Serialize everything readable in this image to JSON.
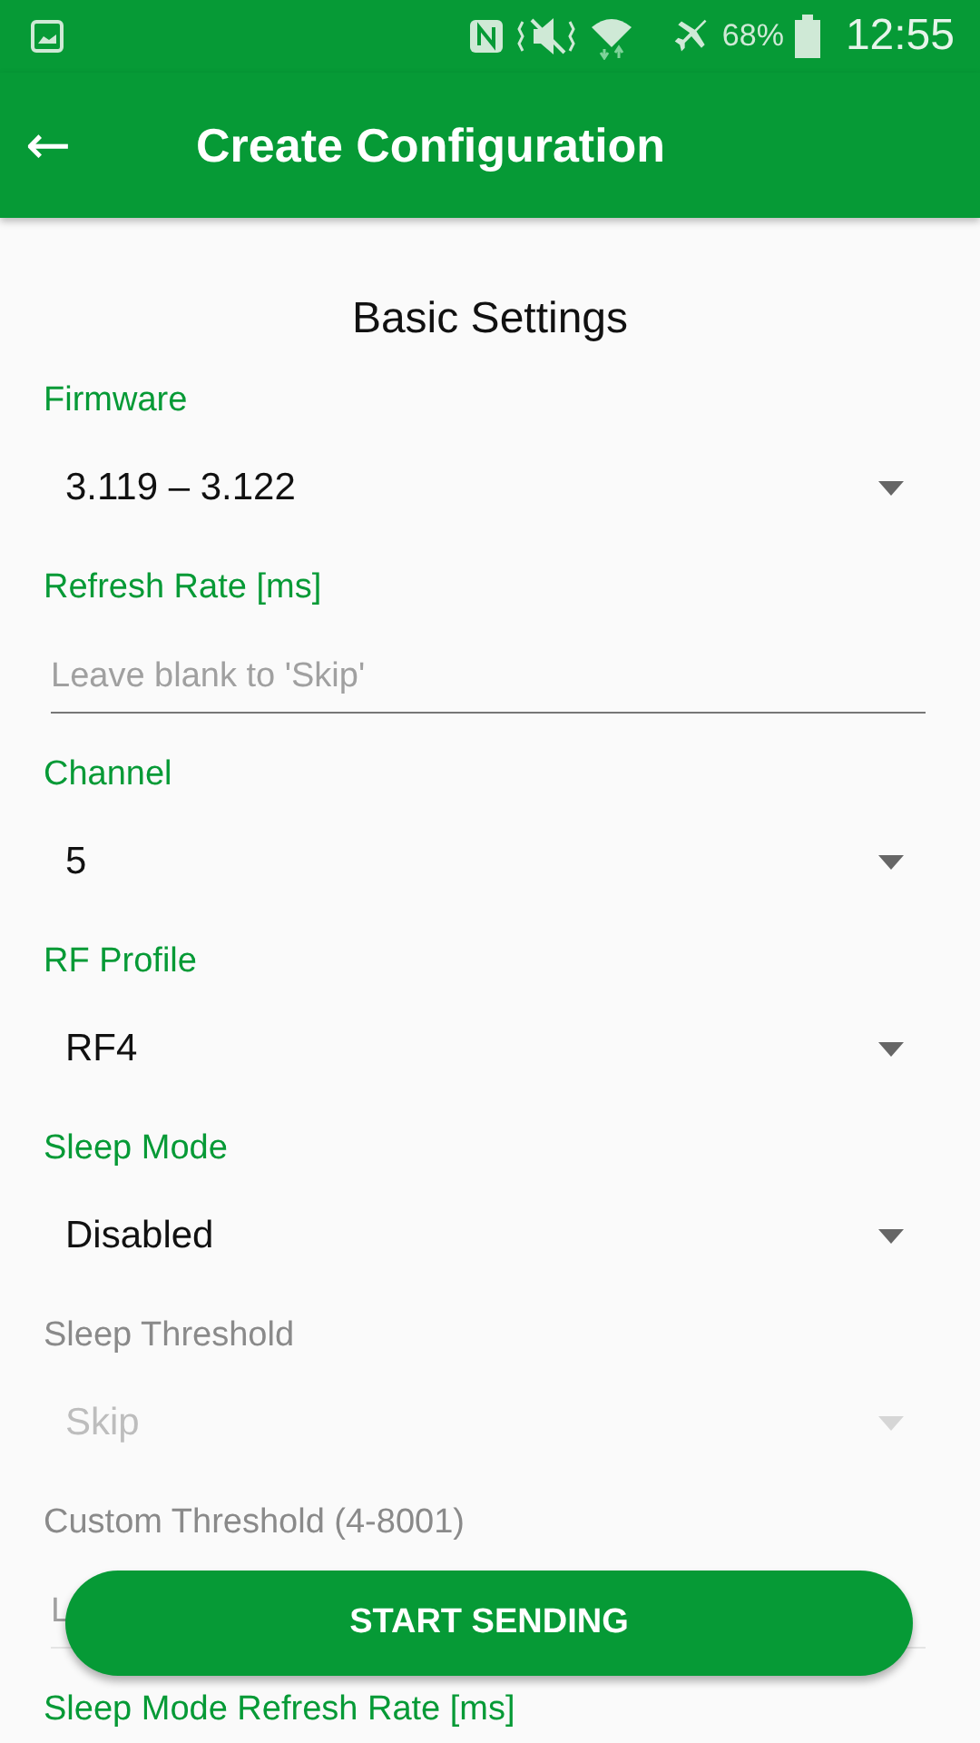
{
  "status_bar": {
    "battery": "68%",
    "time": "12:55"
  },
  "app_bar": {
    "back_icon": "←",
    "title": "Create Configuration"
  },
  "section_title": "Basic Settings",
  "fields": [
    {
      "kind": "dropdown",
      "label": "Firmware",
      "value": "3.119 – 3.122",
      "disabled": false
    },
    {
      "kind": "text",
      "label": "Refresh Rate [ms]",
      "placeholder": "Leave blank to 'Skip'",
      "disabled": false
    },
    {
      "kind": "dropdown",
      "label": "Channel",
      "value": "5",
      "disabled": false
    },
    {
      "kind": "dropdown",
      "label": "RF Profile",
      "value": "RF4",
      "disabled": false
    },
    {
      "kind": "dropdown",
      "label": "Sleep Mode",
      "value": "Disabled",
      "disabled": false
    },
    {
      "kind": "dropdown",
      "label": "Sleep Threshold",
      "value": "Skip",
      "disabled": true
    },
    {
      "kind": "text",
      "label": "Custom Threshold (4-8001)",
      "placeholder": "L",
      "disabled": true
    },
    {
      "kind": "label",
      "label": "Sleep Mode Refresh Rate [ms]",
      "disabled": false
    }
  ],
  "primary_button": "START SENDING"
}
